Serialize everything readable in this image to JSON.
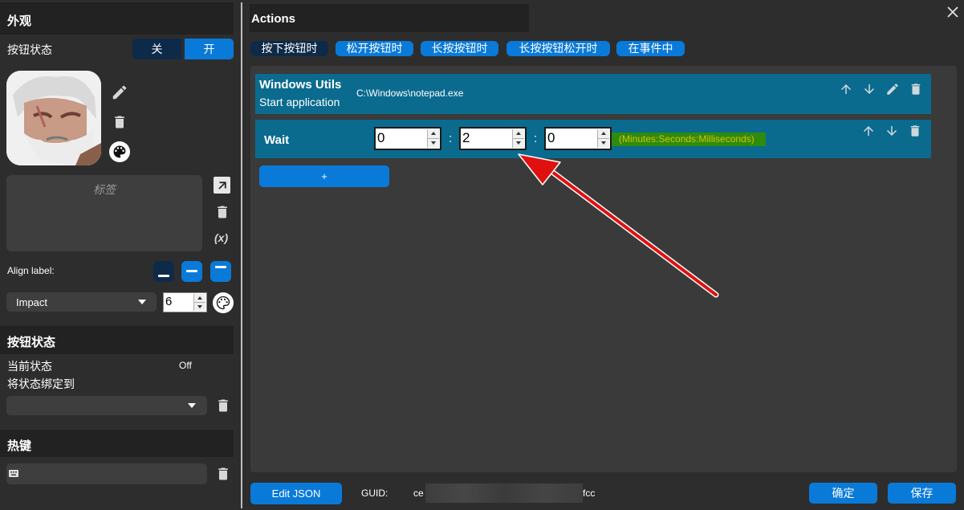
{
  "left": {
    "appearance_header": "外观",
    "button_state_label": "按钮状态",
    "toggle_off": "关",
    "toggle_on": "开",
    "label_placeholder": "标签",
    "variable_icon_text": "(x)",
    "align_label": "Align label:",
    "font_name": "Impact",
    "font_size": "6",
    "state_header": "按钮状态",
    "current_state_label": "当前状态",
    "current_state_value": "Off",
    "bind_state_label": "将状态绑定到",
    "hotkey_header": "热键"
  },
  "right": {
    "actions_header": "Actions",
    "tabs": [
      "按下按钮时",
      "松开按钮时",
      "长按按钮时",
      "长按按钮松开时",
      "在事件中"
    ],
    "active_tab": 0,
    "action1": {
      "title": "Windows Utils",
      "subtitle": "Start application",
      "path": "C:\\Windows\\notepad.exe"
    },
    "wait": {
      "title": "Wait",
      "minutes": "0",
      "seconds": "2",
      "milliseconds": "0",
      "sep": ":",
      "hint": "(Minutes:Seconds:Milliseconds)"
    },
    "add_label": "+",
    "edit_json_label": "Edit JSON",
    "guid_label": "GUID:",
    "guid_start": "ce",
    "guid_end": "fcc",
    "ok_label": "确定",
    "save_label": "保存"
  },
  "colors": {
    "accent": "#0a7ad8",
    "dark_selected": "#0e2a49",
    "row": "#0a6b8e",
    "hint_bg": "#2e8b0e",
    "hint_text": "#d9c200",
    "arrow": "#e01010"
  },
  "icons": {
    "edit": "pencil-icon",
    "delete": "trash-icon",
    "palette": "palette-icon",
    "open": "arrow-up-right-icon",
    "keyboard": "keyboard-icon",
    "up": "arrow-up-icon",
    "down": "arrow-down-icon",
    "close": "close-icon"
  }
}
